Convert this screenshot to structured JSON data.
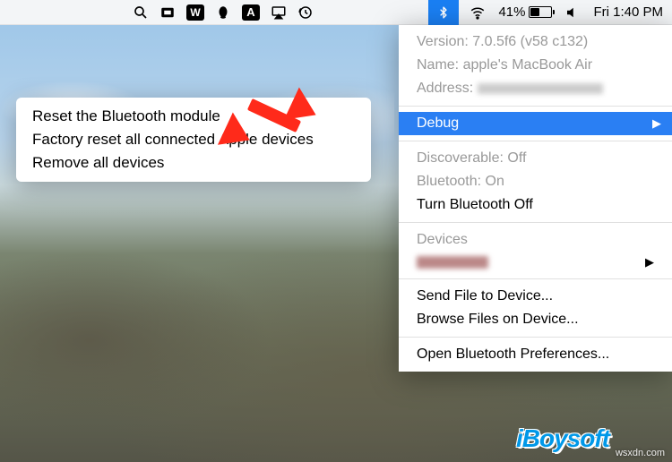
{
  "menubar": {
    "battery_pct": "41%",
    "clock": "Fri 1:40 PM"
  },
  "dropdown": {
    "version_label": "Version:",
    "version_value": "7.0.5f6 (v58 c132)",
    "name_label": "Name:",
    "name_value": "apple's MacBook Air",
    "address_label": "Address:",
    "debug": "Debug",
    "discoverable": "Discoverable: Off",
    "bluetooth_status": "Bluetooth: On",
    "turn_off": "Turn Bluetooth Off",
    "devices_header": "Devices",
    "send_file": "Send File to Device...",
    "browse_files": "Browse Files on Device...",
    "open_prefs": "Open Bluetooth Preferences..."
  },
  "submenu": {
    "reset": "Reset the Bluetooth module",
    "factory": "Factory reset all connected Apple devices",
    "remove": "Remove all devices"
  },
  "watermarks": {
    "brand": "iBoysoft",
    "site": "wsxdn.com"
  }
}
